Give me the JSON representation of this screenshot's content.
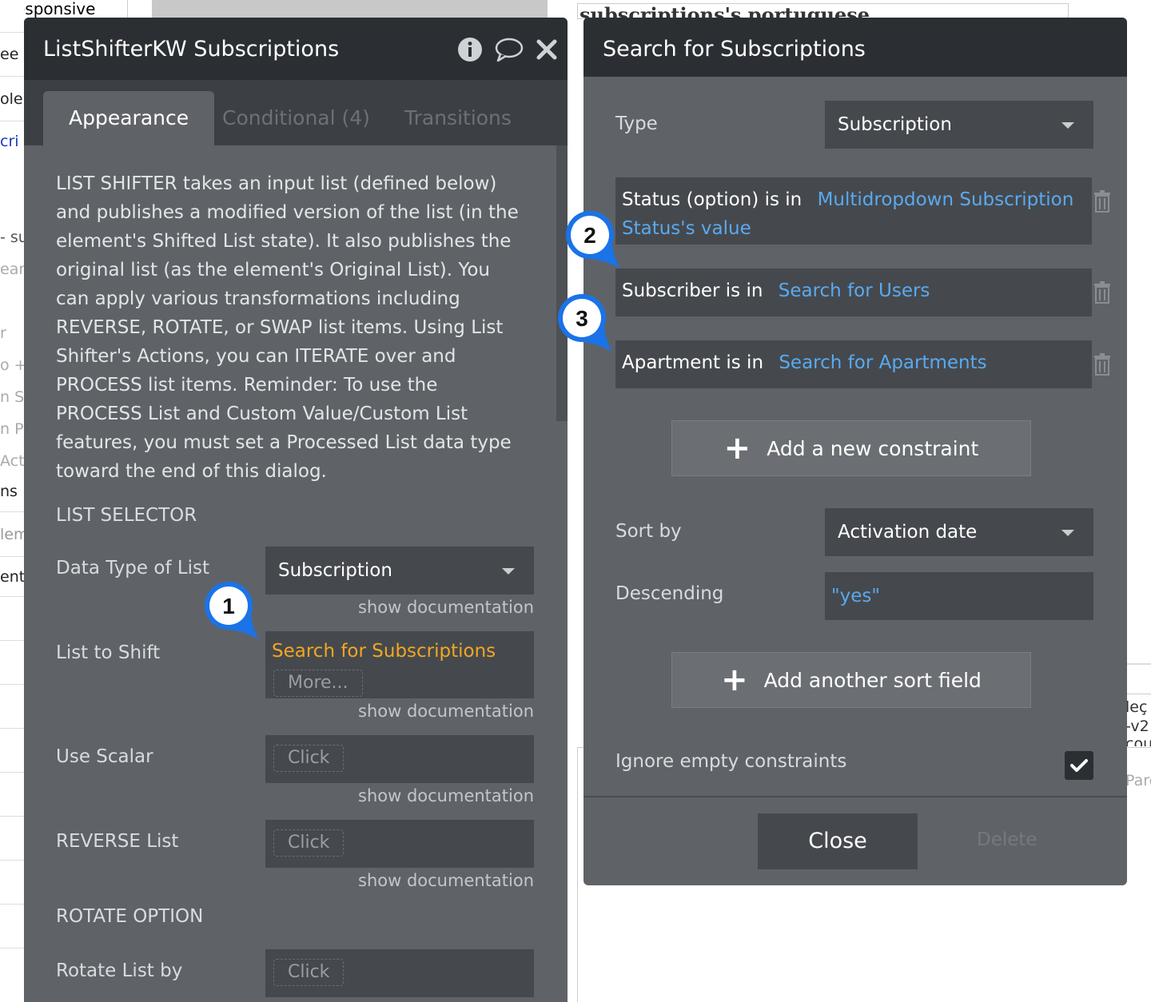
{
  "background": {
    "top_left_label": "Responsive",
    "left_fragments": [
      "ee",
      "ole",
      "cri",
      "- su",
      "ear",
      "r",
      "o +",
      "n St",
      "n P",
      "Acti",
      "ns",
      "lem",
      "ent"
    ],
    "title_overlap": "subscriptions's portuguese",
    "right_fragments": [
      "leç",
      "-v2",
      "cou",
      "Pare"
    ]
  },
  "left_panel": {
    "title": "ListShifterKW Subscriptions",
    "icons": [
      "info-icon",
      "comment-icon",
      "close-icon"
    ],
    "tabs": [
      "Appearance",
      "Conditional (4)",
      "Transitions"
    ],
    "description": "LIST SHIFTER takes an input list (defined below) and publishes a modified version of the list (in the element's Shifted List state). It also publishes the original list (as the element's Original List). You can apply various transformations including REVERSE, ROTATE, or SWAP list items. Using List Shifter's Actions, you can ITERATE over and PROCESS list items. Reminder: To use the PROCESS List and Custom Value/Custom List features, you must set a Processed List data type toward the end of this dialog.",
    "section_list_selector": "LIST SELECTOR",
    "data_type_label": "Data Type of List",
    "data_type_value": "Subscription",
    "show_documentation": "show documentation",
    "list_to_shift_label": "List to Shift",
    "list_to_shift_value": "Search for Subscriptions",
    "more_label": "More...",
    "use_scalar_label": "Use Scalar",
    "click_label": "Click",
    "reverse_label": "REVERSE List",
    "section_rotate": "ROTATE OPTION",
    "rotate_label": "Rotate List by"
  },
  "right_panel": {
    "title": "Search for Subscriptions",
    "type_label": "Type",
    "type_value": "Subscription",
    "constraints": [
      {
        "prefix": "Status (option) is in",
        "value": "Multidropdown Subscription Status's value"
      },
      {
        "prefix": "Subscriber is in",
        "value": "Search for Users"
      },
      {
        "prefix": "Apartment is in",
        "value": "Search for Apartments"
      }
    ],
    "add_constraint": "Add a new constraint",
    "sort_by_label": "Sort by",
    "sort_by_value": "Activation date",
    "descending_label": "Descending",
    "descending_value": "\"yes\"",
    "add_sort": "Add another sort field",
    "ignore_label": "Ignore empty constraints",
    "ignore_checked": true,
    "close_label": "Close",
    "delete_label": "Delete"
  },
  "badges": [
    "1",
    "2",
    "3"
  ],
  "colors": {
    "badge_blue": "#1a73e8",
    "orange": "#f2a623",
    "link_blue": "#5aa9f0",
    "panel_bg": "#5f6368",
    "header_bg": "#2b2f33"
  }
}
